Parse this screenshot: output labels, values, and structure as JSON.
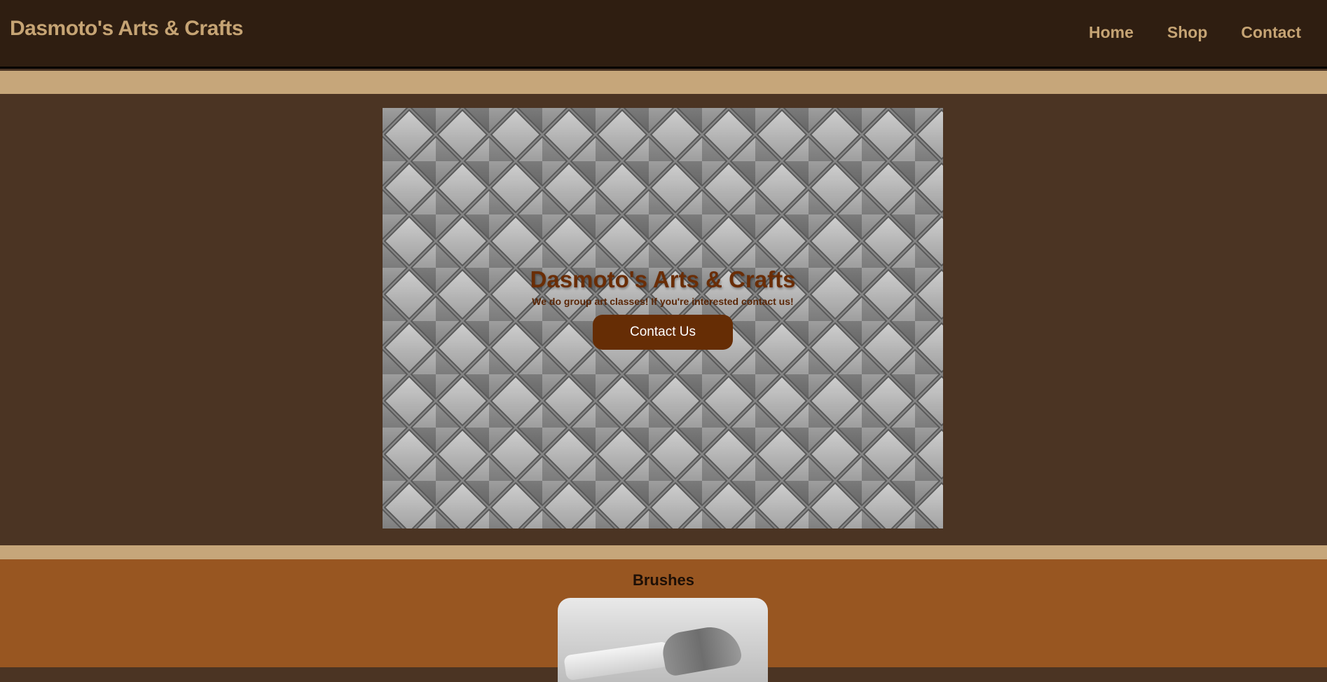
{
  "header": {
    "brand": "Dasmoto's Arts & Crafts",
    "nav": [
      "Home",
      "Shop",
      "Contact"
    ]
  },
  "hero": {
    "title": "Dasmoto's Arts & Crafts",
    "subtitle": "We do group art classes! If you're interested contact us!",
    "button_label": "Contact Us"
  },
  "products": {
    "section_title": "Brushes"
  },
  "colors": {
    "header_bg": "#2f1e11",
    "header_text": "#c6a474",
    "band": "#c6a67a",
    "page_bg": "#4b3423",
    "button_bg": "#662d05",
    "products_bg": "#985621"
  },
  "icons": {}
}
